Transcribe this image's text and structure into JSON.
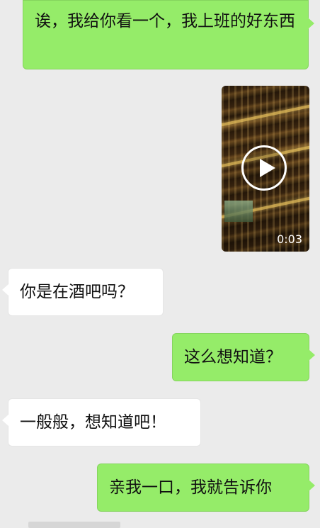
{
  "messages": [
    {
      "side": "right",
      "type": "text",
      "text": "诶，我给你看一个，我上班的好东西"
    },
    {
      "side": "right",
      "type": "video",
      "duration": "0:03"
    },
    {
      "side": "left",
      "type": "text",
      "text": "你是在酒吧吗？"
    },
    {
      "side": "right",
      "type": "text",
      "text": "这么想知道？"
    },
    {
      "side": "left",
      "type": "text",
      "text": "一般般，想知道吧！"
    },
    {
      "side": "right",
      "type": "text",
      "text": "亲我一口，我就告诉你"
    }
  ],
  "colors": {
    "background": "#ebebeb",
    "my_bubble": "#95ec69",
    "their_bubble": "#ffffff"
  },
  "icons": {
    "play": "play-icon"
  }
}
